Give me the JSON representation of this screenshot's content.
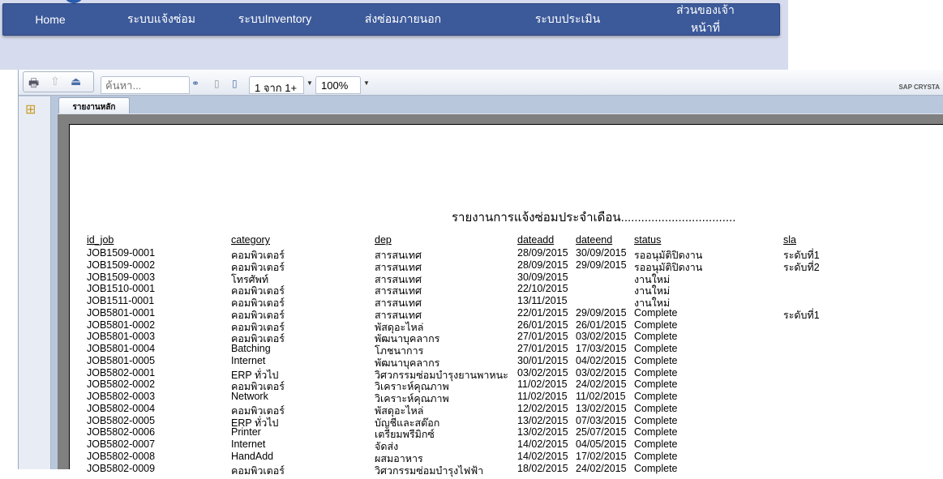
{
  "nav": [
    "Home",
    "ระบบแจ้งซ่อม",
    "ระบบInventory",
    "ส่งซ่อมภายนอก",
    "ระบบประเมิน",
    "ส่วนของเจ้าหน้าที่"
  ],
  "toolbar": {
    "search_placeholder": "ค้นหา...",
    "page": "1 จาก 1+",
    "zoom": "100%",
    "brand": "SAP CRYSTA"
  },
  "tab": "รายงานหลัก",
  "report": {
    "title": "รายงานการแจ้งซ่อมประจำเดือน..................................",
    "headers": [
      "id_job",
      "category",
      "dep",
      "dateadd",
      "dateend",
      "status",
      "sla"
    ],
    "rows": [
      [
        "JOB1509-0001",
        "คอมพิวเตอร์",
        "สารสนเทศ",
        "28/09/2015",
        "30/09/2015",
        "รออนุมัติปิดงาน",
        "ระดับที่1"
      ],
      [
        "JOB1509-0002",
        "คอมพิวเตอร์",
        "สารสนเทศ",
        "28/09/2015",
        "29/09/2015",
        "รออนุมัติปิดงาน",
        "ระดับที่2"
      ],
      [
        "JOB1509-0003",
        "โทรศัพท์",
        "สารสนเทศ",
        "30/09/2015",
        "",
        "งานใหม่",
        ""
      ],
      [
        "JOB1510-0001",
        "คอมพิวเตอร์",
        "สารสนเทศ",
        "22/10/2015",
        "",
        "งานใหม่",
        ""
      ],
      [
        "JOB1511-0001",
        "คอมพิวเตอร์",
        "สารสนเทศ",
        "13/11/2015",
        "",
        "งานใหม่",
        ""
      ],
      [
        "JOB5801-0001",
        "คอมพิวเตอร์",
        "สารสนเทศ",
        "22/01/2015",
        "29/09/2015",
        "Complete",
        "ระดับที่1"
      ],
      [
        "JOB5801-0002",
        "คอมพิวเตอร์",
        "พัสดุอะไหล่",
        "26/01/2015",
        "26/01/2015",
        "Complete",
        ""
      ],
      [
        "JOB5801-0003",
        "คอมพิวเตอร์",
        "พัฒนาบุคลากร",
        "27/01/2015",
        "03/02/2015",
        "Complete",
        ""
      ],
      [
        "JOB5801-0004",
        "Batching",
        "โภชนาการ",
        "27/01/2015",
        "17/03/2015",
        "Complete",
        ""
      ],
      [
        "JOB5801-0005",
        "Internet",
        "พัฒนาบุคลากร",
        "30/01/2015",
        "04/02/2015",
        "Complete",
        ""
      ],
      [
        "JOB5802-0001",
        "ERP ทั่วไป",
        "วิศวกรรมซ่อมบำรุงยานพาหนะ",
        "03/02/2015",
        "03/02/2015",
        "Complete",
        ""
      ],
      [
        "JOB5802-0002",
        "คอมพิวเตอร์",
        "วิเคราะห์คุณภาพ",
        "11/02/2015",
        "24/02/2015",
        "Complete",
        ""
      ],
      [
        "JOB5802-0003",
        "Network",
        "วิเคราะห์คุณภาพ",
        "11/02/2015",
        "11/02/2015",
        "Complete",
        ""
      ],
      [
        "JOB5802-0004",
        "คอมพิวเตอร์",
        "พัสดุอะไหล่",
        "12/02/2015",
        "13/02/2015",
        "Complete",
        ""
      ],
      [
        "JOB5802-0005",
        "ERP ทั่วไป",
        "บัญชีและสต๊อก",
        "13/02/2015",
        "07/03/2015",
        "Complete",
        ""
      ],
      [
        "JOB5802-0006",
        "Printer",
        "เตรียมพรีมิกซ์",
        "13/02/2015",
        "25/07/2015",
        "Complete",
        ""
      ],
      [
        "JOB5802-0007",
        "Internet",
        "จัดส่ง",
        "14/02/2015",
        "04/05/2015",
        "Complete",
        ""
      ],
      [
        "JOB5802-0008",
        "HandAdd",
        "ผสมอาหาร",
        "14/02/2015",
        "17/02/2015",
        "Complete",
        ""
      ],
      [
        "JOB5802-0009",
        "คอมพิวเตอร์",
        "วิศวกรรมซ่อมบำรุงไฟฟ้า",
        "18/02/2015",
        "24/02/2015",
        "Complete",
        ""
      ]
    ]
  }
}
